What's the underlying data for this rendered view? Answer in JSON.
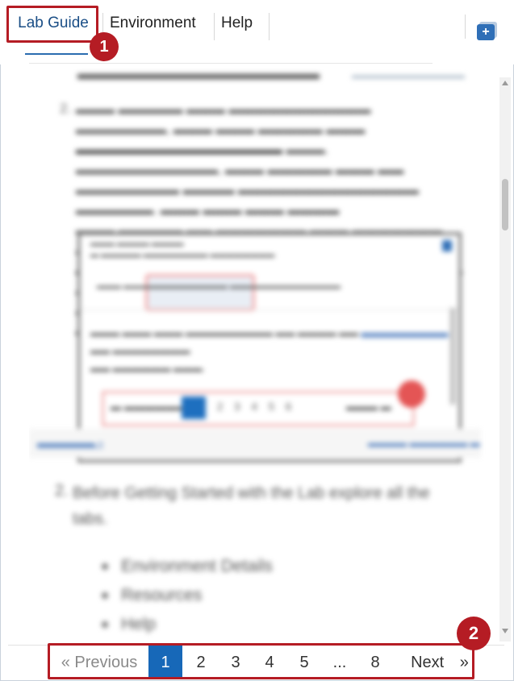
{
  "tabs": [
    {
      "label": "Lab Guide",
      "active": true
    },
    {
      "label": "Environment",
      "active": false
    },
    {
      "label": "Help",
      "active": false
    }
  ],
  "corner_button": {
    "icon": "plus-square-icon",
    "label": "+"
  },
  "annotations": {
    "badge_1": "1",
    "badge_2": "2",
    "color": "#b51c24"
  },
  "guide": {
    "step_2_number": "2.",
    "step_2_title": "Before Getting Started with the Lab explore all the",
    "step_2_title_2": "tabs.",
    "bullets": [
      "Environment Details",
      "Resources",
      "Help"
    ]
  },
  "pagination": {
    "previous": "« Previous",
    "pages": [
      "1",
      "2",
      "3",
      "4",
      "5",
      "...",
      "8"
    ],
    "current": "1",
    "next": "Next",
    "next_arrow": "»",
    "accent": "#1768b8"
  }
}
